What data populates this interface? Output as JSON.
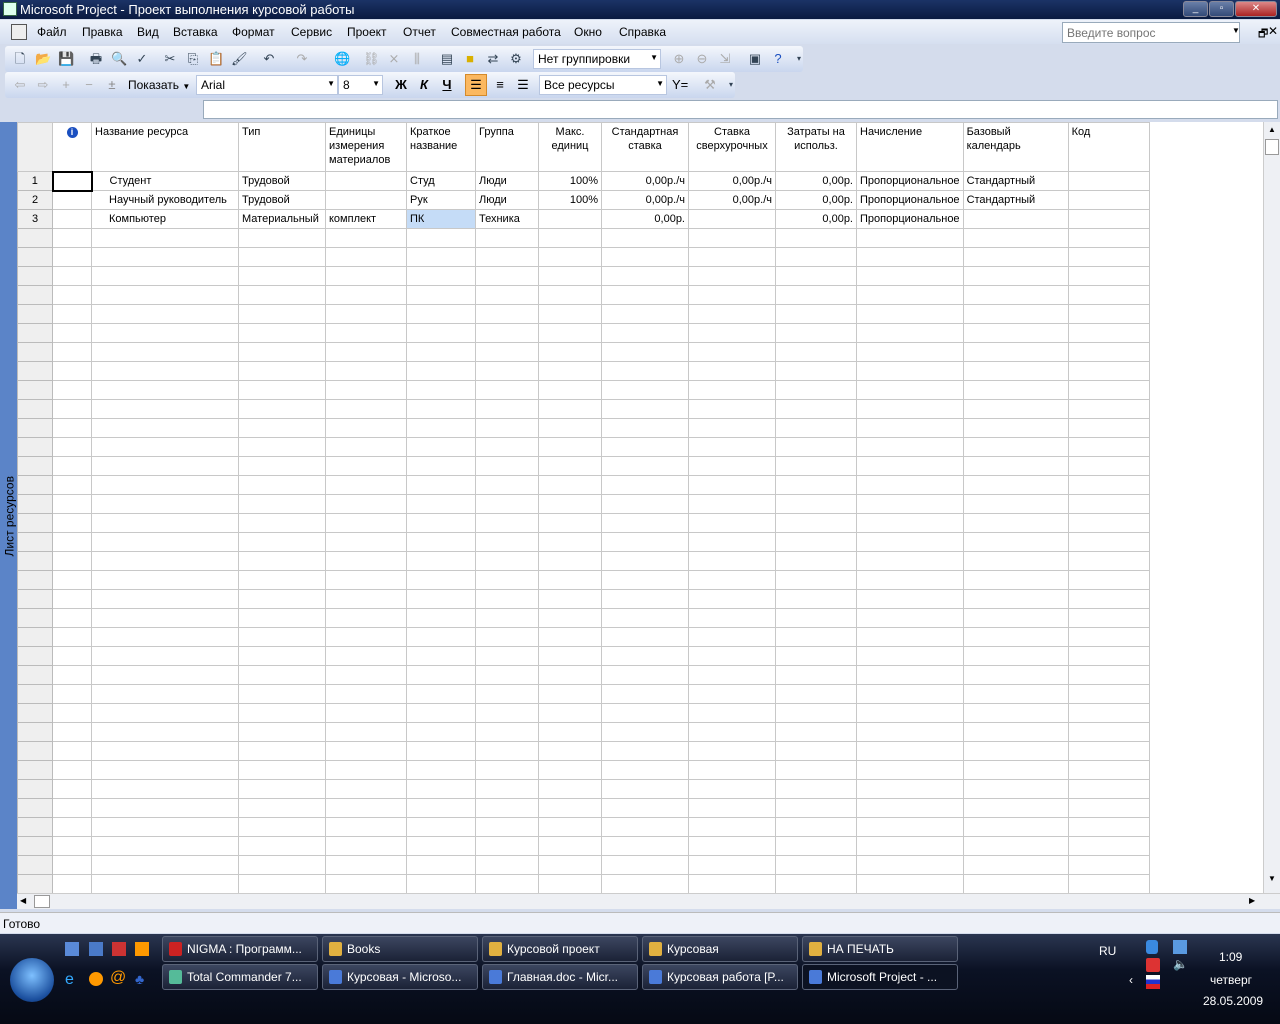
{
  "window": {
    "title": "Microsoft Project - Проект выполнения курсовой работы"
  },
  "menu": [
    "Файл",
    "Правка",
    "Вид",
    "Вставка",
    "Формат",
    "Сервис",
    "Проект",
    "Отчет",
    "Совместная работа",
    "Окно",
    "Справка"
  ],
  "ask_placeholder": "Введите вопрос",
  "toolbar": {
    "grouping": "Нет группировки",
    "show": "Показать",
    "font": "Arial",
    "size": "8",
    "bold": "Ж",
    "italic": "К",
    "underline": "Ч",
    "filter": "Все ресурсы"
  },
  "view_bar": "Лист ресурсов",
  "columns": [
    "Название ресурса",
    "Тип",
    "Единицы измерения материалов",
    "Краткое название",
    "Группа",
    "Макс. единиц",
    "Стандартная ставка",
    "Ставка сверхурочных",
    "Затраты на использ.",
    "Начисление",
    "Базовый календарь",
    "Код"
  ],
  "rows": [
    {
      "id": "1",
      "name": "Студент",
      "type": "Трудовой",
      "units": "",
      "short": "Студ",
      "group": "Люди",
      "max": "100%",
      "std": "0,00р./ч",
      "ovt": "0,00р./ч",
      "cost": "0,00р.",
      "accrue": "Пропорциональное",
      "calendar": "Стандартный",
      "code": ""
    },
    {
      "id": "2",
      "name": "Научный руководитель",
      "type": "Трудовой",
      "units": "",
      "short": "Рук",
      "group": "Люди",
      "max": "100%",
      "std": "0,00р./ч",
      "ovt": "0,00р./ч",
      "cost": "0,00р.",
      "accrue": "Пропорциональное",
      "calendar": "Стандартный",
      "code": ""
    },
    {
      "id": "3",
      "name": "Компьютер",
      "type": "Материальный",
      "units": "комплект",
      "short": "ПК",
      "group": "Техника",
      "max": "",
      "std": "0,00р.",
      "ovt": "",
      "cost": "0,00р.",
      "accrue": "Пропорциональное",
      "calendar": "",
      "code": ""
    }
  ],
  "status": "Готово",
  "taskbar": {
    "row1": [
      "NIGMA : Программ...",
      "Books",
      "Курсовой проект",
      "Курсовая",
      "НА ПЕЧАТЬ"
    ],
    "row2": [
      "Total Commander 7...",
      "Курсовая - Microso...",
      "Главная.doc - Micr...",
      "Курсовая работа [P...",
      "Microsoft Project - ..."
    ],
    "lang": "RU",
    "time": "1:09",
    "day": "четверг",
    "date": "28.05.2009"
  }
}
